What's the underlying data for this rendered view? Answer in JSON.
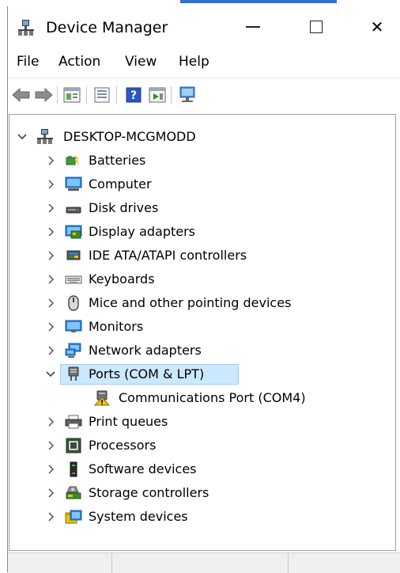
{
  "window": {
    "title": "Device Manager",
    "title_icon": "device-manager-icon",
    "controls": {
      "minimize": "minimize-icon",
      "maximize": "maximize-icon",
      "close": "close-icon",
      "close_glyph": "✕"
    }
  },
  "menu": [
    "File",
    "Action",
    "View",
    "Help"
  ],
  "toolbar": {
    "buttons": [
      "back-arrow-icon",
      "forward-arrow-icon",
      "properties-icon",
      "view-icon",
      "help-icon",
      "run-icon",
      "scan-hardware-icon"
    ]
  },
  "tree": {
    "root": {
      "label": "DESKTOP-MCGMODD",
      "icon": "computer-tree-icon",
      "expanded": true
    },
    "items": [
      {
        "label": "Batteries",
        "icon": "batteries-icon",
        "expanded": false
      },
      {
        "label": "Computer",
        "icon": "computer-icon",
        "expanded": false
      },
      {
        "label": "Disk drives",
        "icon": "disk-drive-icon",
        "expanded": false
      },
      {
        "label": "Display adapters",
        "icon": "display-adapter-icon",
        "expanded": false
      },
      {
        "label": "IDE ATA/ATAPI controllers",
        "icon": "ide-controller-icon",
        "expanded": false
      },
      {
        "label": "Keyboards",
        "icon": "keyboard-icon",
        "expanded": false
      },
      {
        "label": "Mice and other pointing devices",
        "icon": "mouse-icon",
        "expanded": false
      },
      {
        "label": "Monitors",
        "icon": "monitor-icon",
        "expanded": false
      },
      {
        "label": "Network adapters",
        "icon": "network-adapter-icon",
        "expanded": false
      },
      {
        "label": "Ports (COM & LPT)",
        "icon": "port-icon",
        "expanded": true,
        "selected": true,
        "children": [
          {
            "label": "Communications Port (COM4)",
            "icon": "port-warning-icon"
          }
        ]
      },
      {
        "label": "Print queues",
        "icon": "printer-icon",
        "expanded": false
      },
      {
        "label": "Processors",
        "icon": "processor-icon",
        "expanded": false
      },
      {
        "label": "Software devices",
        "icon": "software-device-icon",
        "expanded": false
      },
      {
        "label": "Storage controllers",
        "icon": "storage-controller-icon",
        "expanded": false
      },
      {
        "label": "System devices",
        "icon": "system-device-icon",
        "expanded": false
      }
    ]
  },
  "colors": {
    "selection": "#cce8ff",
    "selection_border": "#99d1ff",
    "accent": "#2f6fd6"
  }
}
